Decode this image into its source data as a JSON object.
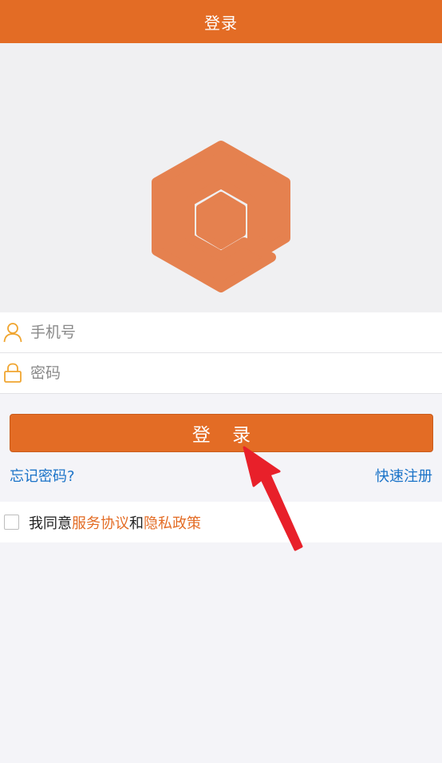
{
  "header": {
    "title": "登录"
  },
  "form": {
    "phone_placeholder": "手机号",
    "password_placeholder": "密码"
  },
  "actions": {
    "login_label": "登 录",
    "forgot_password": "忘记密码?",
    "quick_register": "快速注册"
  },
  "agreement": {
    "prefix": "我同意",
    "service_terms": "服务协议",
    "conjunction": "和",
    "privacy_policy": "隐私政策",
    "checked": false
  },
  "colors": {
    "accent": "#e36c25",
    "link": "#1a73c8",
    "annotation_arrow": "#e8202a"
  },
  "icons": {
    "logo": "hexagon-logo-icon",
    "phone_field": "user-icon",
    "password_field": "lock-icon",
    "annotation": "red-arrow-icon"
  }
}
